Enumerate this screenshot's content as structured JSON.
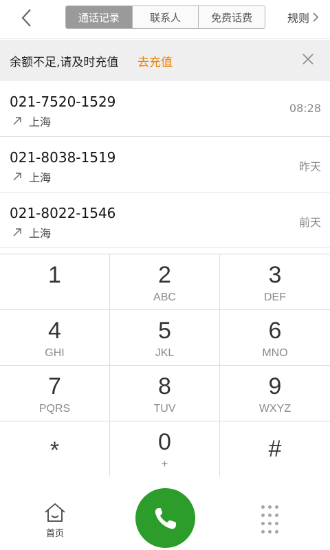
{
  "header": {
    "tabs": [
      {
        "label": "通话记录",
        "active": true
      },
      {
        "label": "联系人",
        "active": false
      },
      {
        "label": "免费话费",
        "active": false
      }
    ],
    "rules_label": "规则"
  },
  "banner": {
    "message": "余额不足,请及时充值",
    "action": "去充值",
    "accent_color": "#f08000"
  },
  "calls": [
    {
      "number": "021-7520-1529",
      "location": "上海",
      "time": "08:28"
    },
    {
      "number": "021-8038-1519",
      "location": "上海",
      "time": "昨天"
    },
    {
      "number": "021-8022-1546",
      "location": "上海",
      "time": "前天"
    }
  ],
  "keypad": [
    {
      "digit": "1",
      "letters": ""
    },
    {
      "digit": "2",
      "letters": "ABC"
    },
    {
      "digit": "3",
      "letters": "DEF"
    },
    {
      "digit": "4",
      "letters": "GHI"
    },
    {
      "digit": "5",
      "letters": "JKL"
    },
    {
      "digit": "6",
      "letters": "MNO"
    },
    {
      "digit": "7",
      "letters": "PQRS"
    },
    {
      "digit": "8",
      "letters": "TUV"
    },
    {
      "digit": "9",
      "letters": "WXYZ"
    },
    {
      "digit": "*",
      "letters": ""
    },
    {
      "digit": "0",
      "letters": "+"
    },
    {
      "digit": "#",
      "letters": ""
    }
  ],
  "bottom": {
    "home_label": "首页",
    "call_color": "#2c9d2a",
    "icons": [
      "home-icon",
      "phone-icon",
      "keypad-grid-icon"
    ]
  }
}
